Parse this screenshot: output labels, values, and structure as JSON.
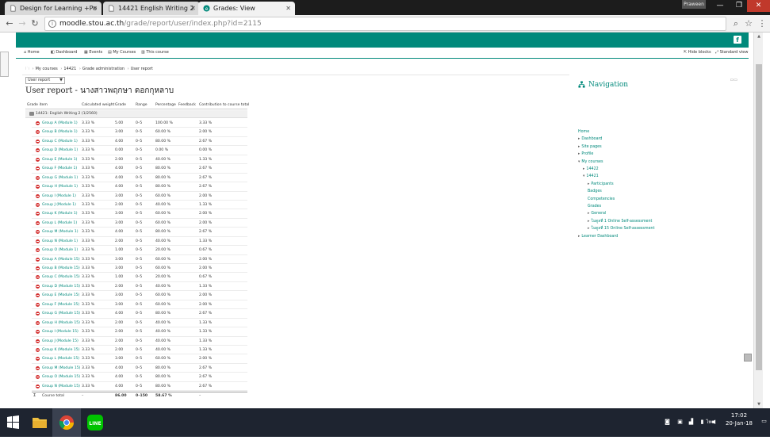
{
  "browser": {
    "tabs": [
      {
        "title": "Design for Learning +Po",
        "active": false
      },
      {
        "title": "14421 English Writing 2",
        "active": false
      },
      {
        "title": "Grades: View",
        "active": true
      }
    ],
    "profile": "Praween",
    "url_host": "moodle.stou.ac.th",
    "url_path": "/grade/report/user/index.php?id=2115"
  },
  "navbar": {
    "items": [
      "Home",
      "Dashboard",
      "Events",
      "My Courses",
      "This course"
    ],
    "right_items": [
      "Hide blocks",
      "Standard view"
    ]
  },
  "breadcrumb": [
    "My courses",
    "14421",
    "Grade administration",
    "User report"
  ],
  "report_select": "User report",
  "page_title": "User report - นางสาวพฤกษา ดอกกุหลาบ",
  "grade_table": {
    "headers": [
      "Grade item",
      "Calculated weight",
      "Grade",
      "Range",
      "Percentage",
      "Feedback",
      "Contribution to course total"
    ],
    "category": "14421: English Writing 2 (1/2560)",
    "rows": [
      {
        "name": "Group A (Module 1)",
        "weight": "3.33 %",
        "grade": "5.00",
        "range": "0–5",
        "percentage": "100.00 %",
        "contribution": "3.33 %"
      },
      {
        "name": "Group B (Module 1)",
        "weight": "3.33 %",
        "grade": "3.00",
        "range": "0–5",
        "percentage": "60.00 %",
        "contribution": "2.00 %"
      },
      {
        "name": "Group C (Module 1)",
        "weight": "3.33 %",
        "grade": "4.00",
        "range": "0–5",
        "percentage": "80.00 %",
        "contribution": "2.67 %"
      },
      {
        "name": "Group D (Module 1)",
        "weight": "3.33 %",
        "grade": "0.00",
        "range": "0–5",
        "percentage": "0.00 %",
        "contribution": "0.00 %"
      },
      {
        "name": "Group E (Module 1)",
        "weight": "3.33 %",
        "grade": "2.00",
        "range": "0–5",
        "percentage": "40.00 %",
        "contribution": "1.33 %"
      },
      {
        "name": "Group F (Module 1)",
        "weight": "3.33 %",
        "grade": "4.00",
        "range": "0–5",
        "percentage": "80.00 %",
        "contribution": "2.67 %"
      },
      {
        "name": "Group G (Module 1)",
        "weight": "3.33 %",
        "grade": "4.00",
        "range": "0–5",
        "percentage": "80.00 %",
        "contribution": "2.67 %"
      },
      {
        "name": "Group H (Module 1)",
        "weight": "3.33 %",
        "grade": "4.00",
        "range": "0–5",
        "percentage": "80.00 %",
        "contribution": "2.67 %"
      },
      {
        "name": "Group I (Module 1)",
        "weight": "3.33 %",
        "grade": "3.00",
        "range": "0–5",
        "percentage": "60.00 %",
        "contribution": "2.00 %"
      },
      {
        "name": "Group J (Module 1)",
        "weight": "3.33 %",
        "grade": "2.00",
        "range": "0–5",
        "percentage": "40.00 %",
        "contribution": "1.33 %"
      },
      {
        "name": "Group K (Module 1)",
        "weight": "3.33 %",
        "grade": "3.00",
        "range": "0–5",
        "percentage": "60.00 %",
        "contribution": "2.00 %"
      },
      {
        "name": "Group L (Module 1)",
        "weight": "3.33 %",
        "grade": "3.00",
        "range": "0–5",
        "percentage": "60.00 %",
        "contribution": "2.00 %"
      },
      {
        "name": "Group M (Module 1)",
        "weight": "3.33 %",
        "grade": "4.00",
        "range": "0–5",
        "percentage": "80.00 %",
        "contribution": "2.67 %"
      },
      {
        "name": "Group N (Module 1)",
        "weight": "3.33 %",
        "grade": "2.00",
        "range": "0–5",
        "percentage": "40.00 %",
        "contribution": "1.33 %"
      },
      {
        "name": "Group O (Module 1)",
        "weight": "3.33 %",
        "grade": "1.00",
        "range": "0–5",
        "percentage": "20.00 %",
        "contribution": "0.67 %"
      },
      {
        "name": "Group A (Module 15)",
        "weight": "3.33 %",
        "grade": "3.00",
        "range": "0–5",
        "percentage": "60.00 %",
        "contribution": "2.00 %"
      },
      {
        "name": "Group B (Module 15)",
        "weight": "3.33 %",
        "grade": "3.00",
        "range": "0–5",
        "percentage": "60.00 %",
        "contribution": "2.00 %"
      },
      {
        "name": "Group C (Module 15)",
        "weight": "3.33 %",
        "grade": "1.00",
        "range": "0–5",
        "percentage": "20.00 %",
        "contribution": "0.67 %"
      },
      {
        "name": "Group D (Module 15)",
        "weight": "3.33 %",
        "grade": "2.00",
        "range": "0–5",
        "percentage": "40.00 %",
        "contribution": "1.33 %"
      },
      {
        "name": "Group E (Module 15)",
        "weight": "3.33 %",
        "grade": "3.00",
        "range": "0–5",
        "percentage": "60.00 %",
        "contribution": "2.00 %"
      },
      {
        "name": "Group F (Module 15)",
        "weight": "3.33 %",
        "grade": "3.00",
        "range": "0–5",
        "percentage": "60.00 %",
        "contribution": "2.00 %"
      },
      {
        "name": "Group G (Module 15)",
        "weight": "3.33 %",
        "grade": "4.00",
        "range": "0–5",
        "percentage": "80.00 %",
        "contribution": "2.67 %"
      },
      {
        "name": "Group H (Module 15)",
        "weight": "3.33 %",
        "grade": "2.00",
        "range": "0–5",
        "percentage": "40.00 %",
        "contribution": "1.33 %"
      },
      {
        "name": "Group I (Module 15)",
        "weight": "3.33 %",
        "grade": "2.00",
        "range": "0–5",
        "percentage": "40.00 %",
        "contribution": "1.33 %"
      },
      {
        "name": "Group J (Module 15)",
        "weight": "3.33 %",
        "grade": "2.00",
        "range": "0–5",
        "percentage": "40.00 %",
        "contribution": "1.33 %"
      },
      {
        "name": "Group K (Module 15)",
        "weight": "3.33 %",
        "grade": "2.00",
        "range": "0–5",
        "percentage": "40.00 %",
        "contribution": "1.33 %"
      },
      {
        "name": "Group L (Module 15)",
        "weight": "3.33 %",
        "grade": "3.00",
        "range": "0–5",
        "percentage": "60.00 %",
        "contribution": "2.00 %"
      },
      {
        "name": "Group M (Module 15)",
        "weight": "3.33 %",
        "grade": "4.00",
        "range": "0–5",
        "percentage": "80.00 %",
        "contribution": "2.67 %"
      },
      {
        "name": "Group O (Module 15)",
        "weight": "3.33 %",
        "grade": "4.00",
        "range": "0–5",
        "percentage": "80.00 %",
        "contribution": "2.67 %"
      },
      {
        "name": "Group N (Module 15)",
        "weight": "3.33 %",
        "grade": "4.00",
        "range": "0–5",
        "percentage": "80.00 %",
        "contribution": "2.67 %"
      }
    ],
    "total": {
      "name": "Course total",
      "weight": "–",
      "grade": "86.00",
      "range": "0–150",
      "percentage": "58.67 %",
      "contribution": "–"
    }
  },
  "navigation": {
    "title": "Navigation",
    "items": [
      {
        "label": "Home",
        "level": 0,
        "arrow": ""
      },
      {
        "label": "Dashboard",
        "level": 0,
        "arrow": "▸"
      },
      {
        "label": "Site pages",
        "level": 0,
        "arrow": "▸"
      },
      {
        "label": "Profile",
        "level": 0,
        "arrow": "▸"
      },
      {
        "label": "My courses",
        "level": 0,
        "arrow": "▾"
      },
      {
        "label": "14422",
        "level": 1,
        "arrow": "▸"
      },
      {
        "label": "14421",
        "level": 1,
        "arrow": "▾"
      },
      {
        "label": "Participants",
        "level": 2,
        "arrow": "▸"
      },
      {
        "label": "Badges",
        "level": 2,
        "arrow": ""
      },
      {
        "label": "Competencies",
        "level": 2,
        "arrow": ""
      },
      {
        "label": "Grades",
        "level": 2,
        "arrow": ""
      },
      {
        "label": "General",
        "level": 2,
        "arrow": "▸"
      },
      {
        "label": "โมดูลที่ 1 Online Self-assessment",
        "level": 2,
        "arrow": "▸"
      },
      {
        "label": "โมดูลที่ 15 Online Self-assessment",
        "level": 2,
        "arrow": "▸"
      },
      {
        "label": "Learner Dashboard",
        "level": 0,
        "arrow": "▸"
      }
    ]
  },
  "taskbar": {
    "language": "ไทย",
    "time": "17:02",
    "date": "20-Jan-18"
  },
  "colors": {
    "accent": "#00897b",
    "grade_icon": "#d32f2f"
  }
}
